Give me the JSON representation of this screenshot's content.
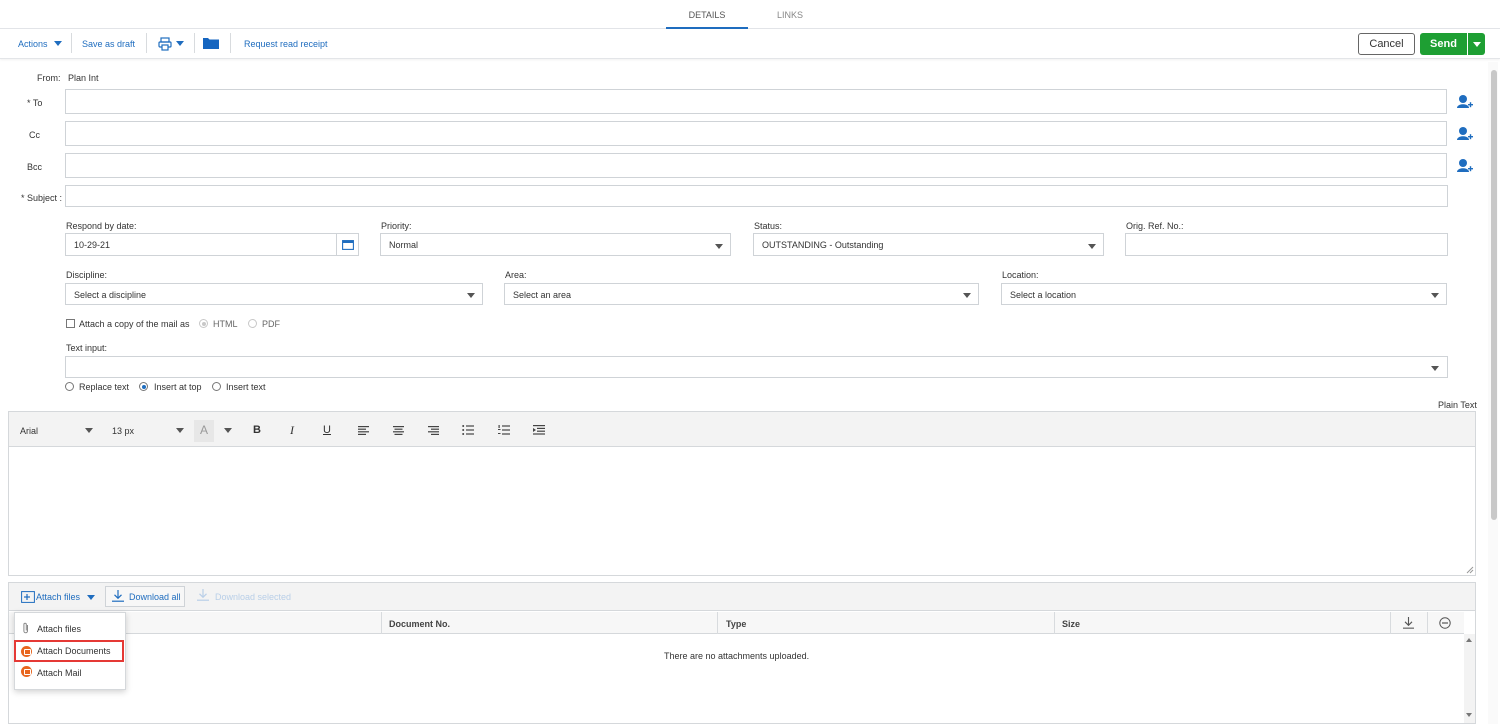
{
  "tabs": [
    {
      "label": "DETAILS",
      "active": true
    },
    {
      "label": "LINKS",
      "active": false
    }
  ],
  "toolbar": {
    "actions": "Actions",
    "save_draft": "Save as draft",
    "request_receipt": "Request read receipt",
    "cancel": "Cancel",
    "send": "Send"
  },
  "header": {
    "from_label": "From:",
    "from_value": "Plan Int",
    "to_label": "* To",
    "cc_label": "Cc",
    "bcc_label": "Bcc",
    "subject_label": "* Subject :"
  },
  "fields": {
    "respond_label": "Respond by date:",
    "respond_value": "10-29-21",
    "priority_label": "Priority:",
    "priority_value": "Normal",
    "status_label": "Status:",
    "status_value": "OUTSTANDING - Outstanding",
    "origref_label": "Orig. Ref. No.:",
    "discipline_label": "Discipline:",
    "discipline_placeholder": "Select a discipline",
    "area_label": "Area:",
    "area_placeholder": "Select an area",
    "location_label": "Location:",
    "location_placeholder": "Select a location",
    "attach_copy_label": "Attach a copy of the mail as",
    "html_label": "HTML",
    "pdf_label": "PDF",
    "text_input_label": "Text input:",
    "replace_text": "Replace text",
    "insert_top": "Insert at top",
    "insert_text": "Insert text"
  },
  "editor": {
    "plain_text": "Plain Text",
    "font": "Arial",
    "size": "13 px",
    "color_glyph": "A",
    "bold": "B",
    "italic": "I",
    "underline": "U"
  },
  "attachments": {
    "attach_files": "Attach files",
    "download_all": "Download all",
    "download_selected": "Download selected",
    "columns": [
      "Document No.",
      "Type",
      "Size"
    ],
    "empty": "There are no attachments uploaded.",
    "menu": [
      "Attach files",
      "Attach Documents",
      "Attach Mail"
    ]
  },
  "colors": {
    "accent": "#1f6dbf",
    "send_green": "#1e9f33",
    "highlight_red": "#e53935",
    "icon_orange": "#e8661f"
  }
}
